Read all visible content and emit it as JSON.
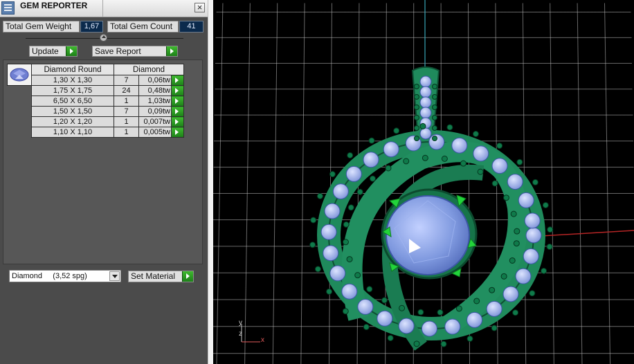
{
  "window": {
    "title": "GEM REPORTER",
    "close_symbol": "×"
  },
  "stats": {
    "total_weight_label": "Total Gem Weight",
    "total_weight_value": "1,67",
    "total_count_label": "Total Gem Count",
    "total_count_value": "41"
  },
  "actions": {
    "update_label": "Update",
    "save_report_label": "Save Report"
  },
  "table": {
    "headers": [
      "Diamond Round",
      "Diamond"
    ],
    "rows": [
      {
        "size": "1,30 X 1,30",
        "count": "7",
        "weight": "0,06tw"
      },
      {
        "size": "1,75 X 1,75",
        "count": "24",
        "weight": "0,48tw"
      },
      {
        "size": "6,50 X 6,50",
        "count": "1",
        "weight": "1,03tw"
      },
      {
        "size": "1,50 X 1,50",
        "count": "7",
        "weight": "0,09tw"
      },
      {
        "size": "1,20 X 1,20",
        "count": "1",
        "weight": "0,007tw"
      },
      {
        "size": "1,10 X 1,10",
        "count": "1",
        "weight": "0,005tw"
      }
    ]
  },
  "material": {
    "selected": "Diamond     (3,52 spg)",
    "set_label": "Set Material"
  },
  "viewport": {
    "axis_labels": {
      "x": "x",
      "y": "y",
      "z": "z"
    },
    "colors": {
      "metal": "#1f8a5c",
      "gem": "#8fa8e8",
      "prong": "#22d43a",
      "background": "#000000",
      "x_axis": "#b52525",
      "y_axis": "#3aa6b8"
    }
  }
}
